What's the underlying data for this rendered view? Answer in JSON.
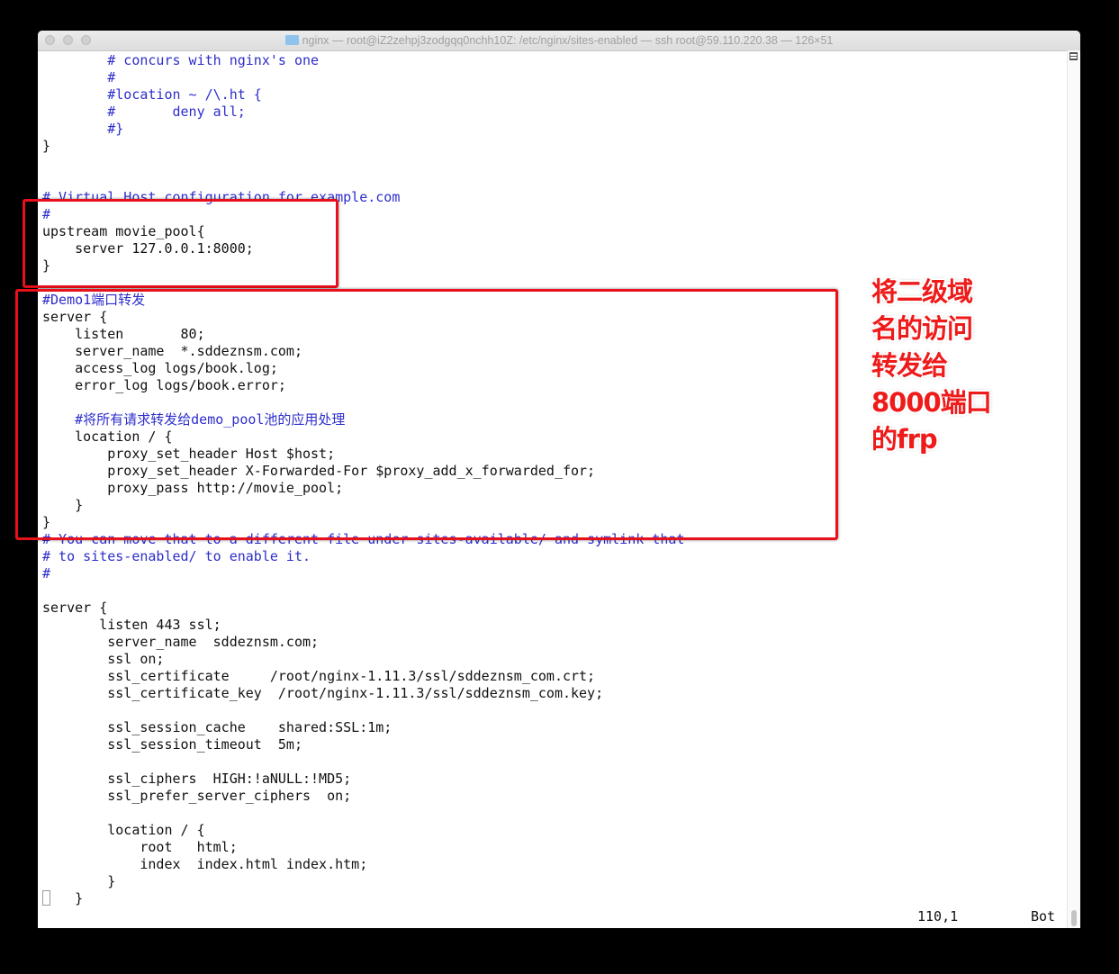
{
  "window": {
    "title": "nginx — root@iZ2zehpj3zodgqq0nchh10Z: /etc/nginx/sites-enabled — ssh root@59.110.220.38 — 126×51",
    "title_icon": "folder-icon"
  },
  "editor": {
    "lines": [
      "        # concurs with nginx's one",
      "        #",
      "        #location ~ /\\.ht {",
      "        #       deny all;",
      "        #}",
      "}",
      "",
      "",
      "# Virtual Host configuration for example.com",
      "#",
      "upstream movie_pool{",
      "    server 127.0.0.1:8000;",
      "}",
      "",
      "#Demo1端口转发",
      "server {",
      "    listen       80;",
      "    server_name  *.sddeznsm.com;",
      "    access_log logs/book.log;",
      "    error_log logs/book.error;",
      "",
      "    #将所有请求转发给demo_pool池的应用处理",
      "    location / {",
      "        proxy_set_header Host $host;",
      "        proxy_set_header X-Forwarded-For $proxy_add_x_forwarded_for;",
      "        proxy_pass http://movie_pool;",
      "    }",
      "}",
      "# You can move that to a different file under sites-available/ and symlink that",
      "# to sites-enabled/ to enable it.",
      "#",
      "",
      "server {",
      "       listen 443 ssl;",
      "        server_name  sddeznsm.com;",
      "        ssl on;",
      "        ssl_certificate     /root/nginx-1.11.3/ssl/sddeznsm_com.crt;",
      "        ssl_certificate_key  /root/nginx-1.11.3/ssl/sddeznsm_com.key;",
      "",
      "        ssl_session_cache    shared:SSL:1m;",
      "        ssl_session_timeout  5m;",
      "",
      "        ssl_ciphers  HIGH:!aNULL:!MD5;",
      "        ssl_prefer_server_ciphers  on;",
      "",
      "        location / {",
      "            root   html;",
      "            index  index.html index.htm;",
      "        }",
      "    }"
    ],
    "status_position": "110,1",
    "status_scroll": "Bot"
  },
  "annotation": {
    "text": "将二级域\n名的访问\n转发给\n8000端口\n的frp",
    "color": "#ef1a1a"
  },
  "colors": {
    "comment": "#2d2dcc",
    "highlight_box": "#e8101a"
  }
}
